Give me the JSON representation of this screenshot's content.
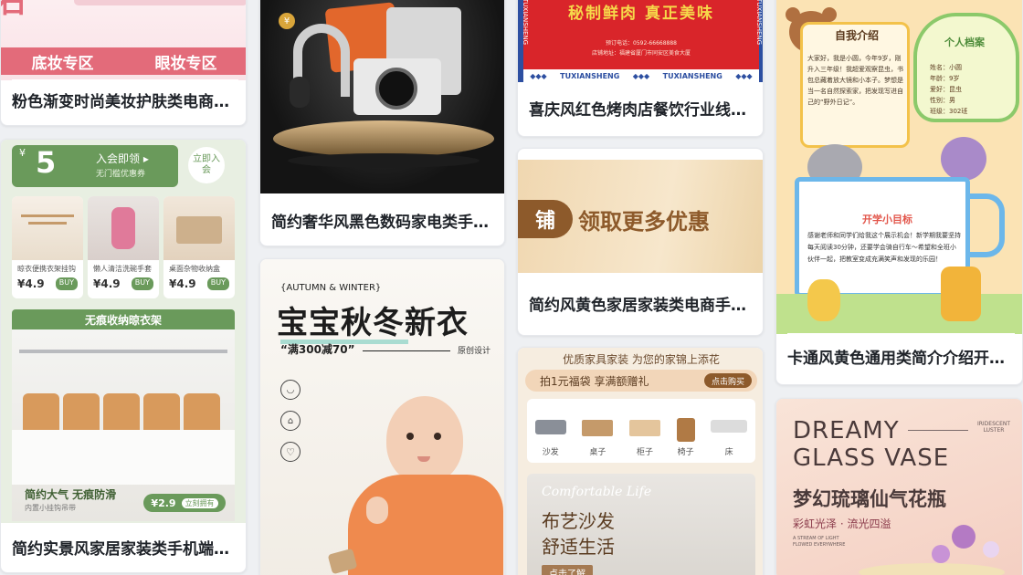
{
  "cards": {
    "c1": {
      "title": "粉色渐变时尚美妆护肤类电商…",
      "banner_left": "底妆专区",
      "banner_right": "眼妆专区"
    },
    "c2": {
      "title": "简约奢华风黑色数码家电类手…"
    },
    "c3": {
      "title": "喜庆风红色烤肉店餐饮行业线…",
      "slogan": "秘制鲜肉  真正美味",
      "phone": "预订电话：0592-66668888",
      "address": "店铺地址：福建省厦门市同安区美食大厦",
      "brand": "TUXIANSHENG",
      "side_brand": "TUXIANSHENG"
    },
    "c4": {
      "title": "卡通风黄色通用类简介介绍开…",
      "intro_label": "自我介绍",
      "profile_label": "个人档案",
      "intro_text": "大家好，我是小圆，今年9岁，刚升入三年级！我超爱观察昆虫，书包总藏着放大镜和小本子。梦想是当一名自然探索家，把发现写进自己的“野外日记”。",
      "goal_label": "开学小目标",
      "goal_text": "感谢老师和同学们给我这个展示机会！新学期我要坚持每天阅读30分钟，还要学会骑自行车～希望和全班小伙伴一起，把教室变成充满笑声和发现的乐园！",
      "profile_items": [
        "姓名：小圆",
        "年龄：9岁",
        "爱好：昆虫",
        "性别：男",
        "班级：302班"
      ]
    },
    "c5": {
      "title": "简约风黄色家居家装类电商手…",
      "tag": "铺",
      "headline": "领取更多优惠"
    },
    "c6": {
      "title": "简约实景风家居家装类手机端…",
      "coupon_symbol": "¥",
      "coupon_value": "5",
      "coupon_line1": "入会即领 ▸",
      "coupon_line2": "无门槛优惠券",
      "join_btn": "立即入会",
      "products": [
        {
          "name": "晾衣便携衣架挂钩",
          "price": "¥4.9",
          "btn": "BUY"
        },
        {
          "name": "懒人清洁洗碗手套",
          "price": "¥4.9",
          "btn": "BUY"
        },
        {
          "name": "桌面杂物收纳盒",
          "price": "¥4.9",
          "btn": "BUY"
        }
      ],
      "section_title": "无痕收纳晾衣架",
      "feature": "简约大气  无痕防滑",
      "feature_sub": "内置小挂钩吊带",
      "feature_price": "¥2.9",
      "feature_btn": "立刻拥有"
    },
    "c7": {
      "season": "{AUTUMN & WINTER}",
      "headline": "宝宝秋冬新衣",
      "promo": "“满300减70”",
      "tag": "原创设计"
    },
    "c8": {
      "header": "优质家具家装  为您的家锦上添花",
      "promo": "拍1元福袋  享满额赠礼",
      "promo_btn": "点击购买",
      "categories": [
        "沙发",
        "桌子",
        "柜子",
        "椅子",
        "床"
      ],
      "script": "Comfortable Life",
      "line1": "布艺沙发",
      "line2": "舒适生活",
      "cta": "点击了解"
    },
    "c9": {
      "en_line1": "DREAMY",
      "en_line2": "GLASS VASE",
      "side_text": "IRIDESCENT LUSTER",
      "cn_title": "梦幻琉璃仙气花瓶",
      "cn_sub": "彩虹光泽 · 流光四溢",
      "small_en": "A STREAM OF LIGHT FLOWED EVERYWHERE"
    }
  },
  "colors": {
    "pink_banner": "#e36b7a",
    "green": "#6a9a5b",
    "red_poster": "#d9252a",
    "yellow_card": "#fbe3b4",
    "vase_bg": "#f7d9cc"
  },
  "icons": [
    "shopping-bag-icon",
    "chat-bubble-icon",
    "home-icon",
    "heart-icon",
    "speaker-icon"
  ]
}
